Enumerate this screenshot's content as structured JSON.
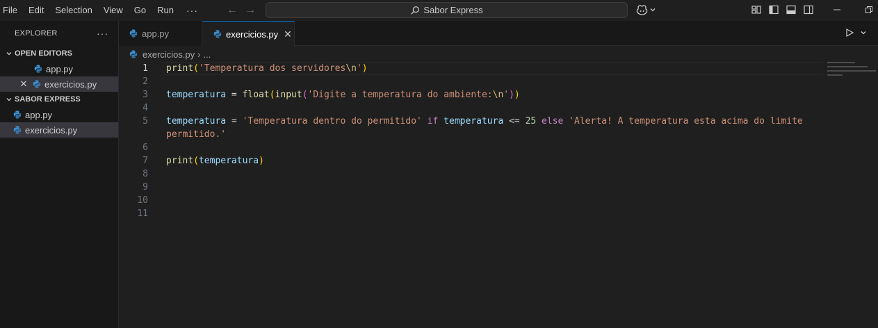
{
  "menu": {
    "items": [
      "File",
      "Edit",
      "Selection",
      "View",
      "Go",
      "Run"
    ],
    "more": "···"
  },
  "command_center": {
    "label": "Sabor Express"
  },
  "sidebar": {
    "title": "EXPLORER",
    "more": "···",
    "open_editors": {
      "header": "OPEN EDITORS",
      "items": [
        {
          "label": "app.py"
        },
        {
          "label": "exercicios.py"
        }
      ]
    },
    "workspace": {
      "header": "SABOR EXPRESS",
      "items": [
        {
          "label": "app.py"
        },
        {
          "label": "exercicios.py"
        }
      ]
    }
  },
  "tabs": [
    {
      "label": "app.py",
      "active": false
    },
    {
      "label": "exercicios.py",
      "active": true,
      "close": "✕"
    }
  ],
  "breadcrumb": {
    "file": "exercicios.py",
    "separator": "›",
    "more": "..."
  },
  "editor": {
    "current_line": 1,
    "line_numbers": [
      "1",
      "2",
      "3",
      "4",
      "5",
      "",
      "6",
      "7",
      "8",
      "9",
      "10",
      "11"
    ],
    "code": {
      "l1_fn": "print",
      "l1_open": "(",
      "l1_str1": "'Temperatura dos servidores",
      "l1_esc": "\\n",
      "l1_str2": "'",
      "l1_close": ")",
      "l3_var": "temperatura",
      "l3_eq": " = ",
      "l3_fn1": "float",
      "l3_open1": "(",
      "l3_fn2": "input",
      "l3_open2": "(",
      "l3_str1": "'Digite a temperatura do ambiente:",
      "l3_esc": "\\n",
      "l3_str2": "'",
      "l3_close2": ")",
      "l3_close1": ")",
      "l5_var": "temperatura",
      "l5_eq": " = ",
      "l5_str1": "'Temperatura dentro do permitido'",
      "l5_if": " if ",
      "l5_var2": "temperatura",
      "l5_le": " <= ",
      "l5_num": "25",
      "l5_else": " else ",
      "l5_str2": "'Alerta! A temperatura esta acima do limite",
      "l5b_str": "permitido.'",
      "l7_fn": "print",
      "l7_open": "(",
      "l7_var": "temperatura",
      "l7_close": ")"
    }
  },
  "colors": {
    "accent": "#0078d4",
    "python_icon": "#3c8fd1"
  }
}
